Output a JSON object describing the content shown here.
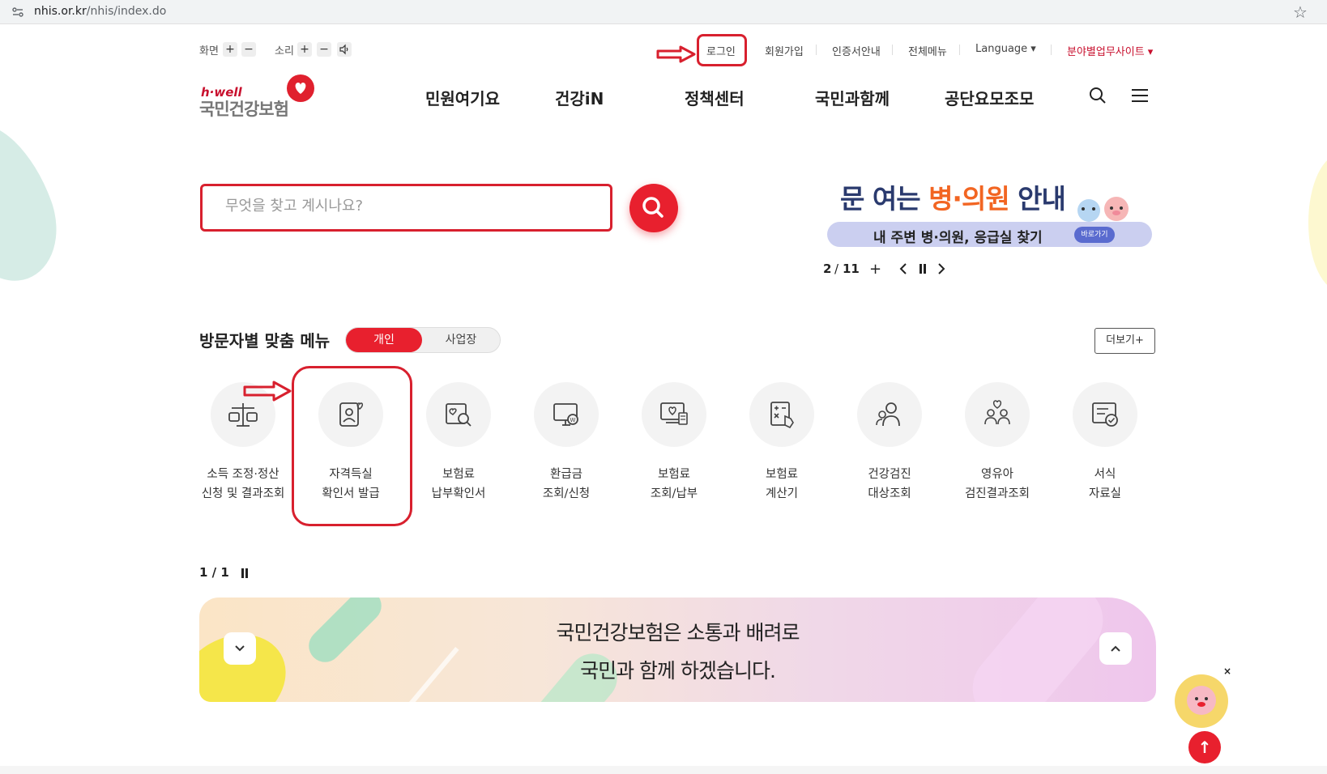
{
  "browser": {
    "url_host": "nhis.or.kr",
    "url_path": "/nhis/index.do"
  },
  "utility": {
    "screen_label": "화면",
    "sound_label": "소리",
    "plus": "+",
    "minus": "−",
    "links": [
      "로그인",
      "회원가입",
      "인증서안내",
      "전체메뉴",
      "Language ▾",
      "분야별업무사이트 ▾"
    ]
  },
  "header": {
    "logo_eng": "h·well",
    "logo_kor": "국민건강보험",
    "nav": [
      "민원여기요",
      "건강iN",
      "정책센터",
      "국민과함께",
      "공단요모조모"
    ]
  },
  "search": {
    "placeholder": "무엇을 찾고 계시나요?"
  },
  "promo": {
    "title_pre": "문 여는 ",
    "title_hl": "병·의원",
    "title_post": " 안내",
    "subtitle": "내 주변 병·의원, 응급실 찾기",
    "go_label": "바로가기",
    "current": "2",
    "total": "11",
    "separator": "/"
  },
  "visitor_menu": {
    "title": "방문자별 맞춤 메뉴",
    "tab_personal": "개인",
    "tab_business": "사업장",
    "more": "더보기+",
    "items": [
      {
        "line1": "소득 조정·정산",
        "line2": "신청 및 결과조회",
        "icon": "scale-icon"
      },
      {
        "line1": "자격득실",
        "line2": "확인서 발급",
        "icon": "person-heart-icon"
      },
      {
        "line1": "보험료",
        "line2": "납부확인서",
        "icon": "document-search-icon"
      },
      {
        "line1": "환급금",
        "line2": "조회/신청",
        "icon": "monitor-coin-icon"
      },
      {
        "line1": "보험료",
        "line2": "조회/납부",
        "icon": "monitor-heart-icon"
      },
      {
        "line1": "보험료",
        "line2": "계산기",
        "icon": "calculator-icon"
      },
      {
        "line1": "건강검진",
        "line2": "대상조회",
        "icon": "group-search-icon"
      },
      {
        "line1": "영유아",
        "line2": "검진결과조회",
        "icon": "family-heart-icon"
      },
      {
        "line1": "서식",
        "line2": "자료실",
        "icon": "form-check-icon"
      }
    ],
    "page": "1 / 1"
  },
  "banner": {
    "line1": "국민건강보험은 소통과 배려로",
    "line2": "국민과 함께 하겠습니다."
  },
  "floating": {
    "close": "×",
    "top": "↑"
  },
  "colors": {
    "brand_red": "#e8202e",
    "annotation_red": "#d8202e",
    "promo_navy": "#2a3a6e",
    "promo_orange": "#f26522"
  }
}
